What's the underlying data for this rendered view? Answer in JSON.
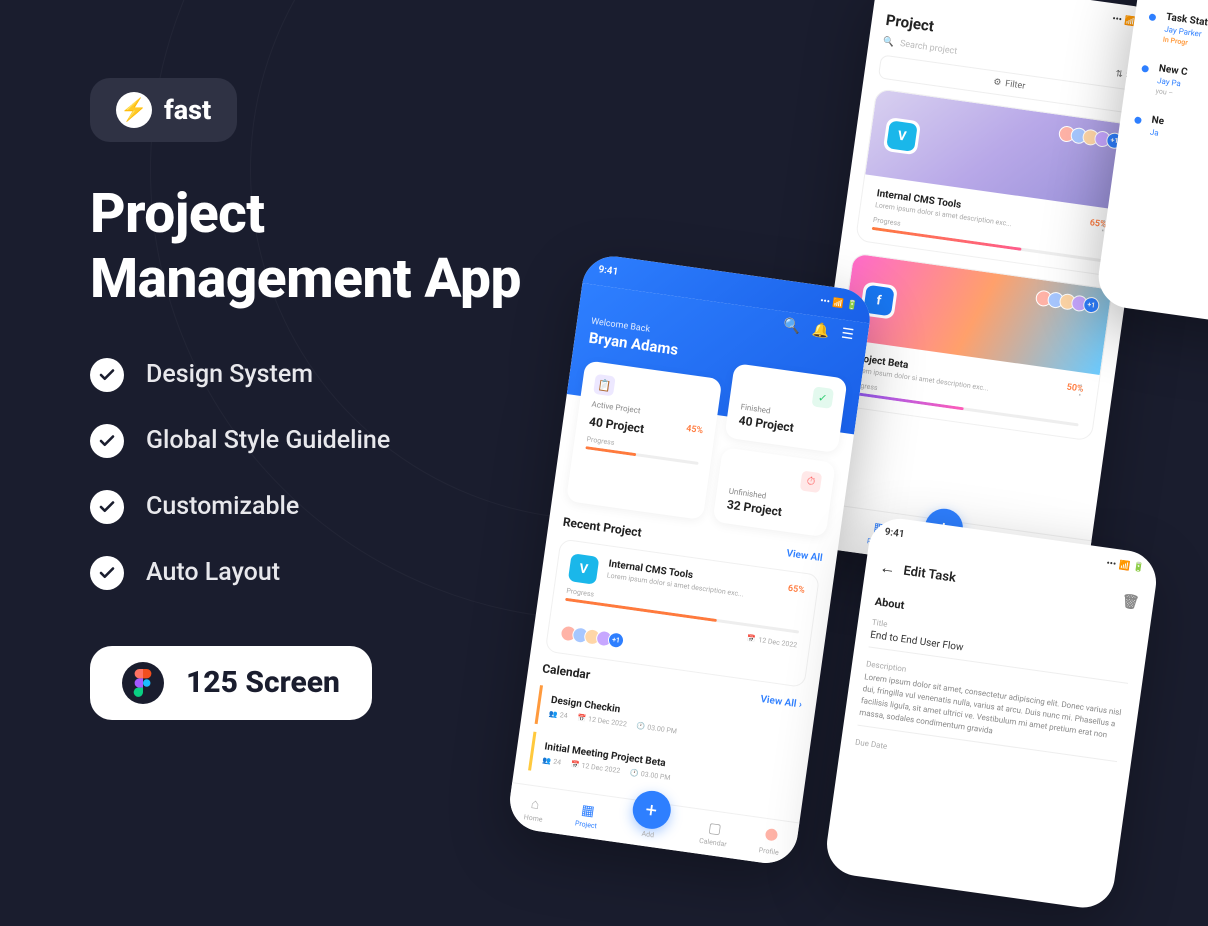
{
  "logo": {
    "text": "fast"
  },
  "title_line1": "Project",
  "title_line2": "Management App",
  "features": [
    "Design System",
    "Global Style Guideline",
    "Customizable",
    "Auto Layout"
  ],
  "screen_badge": "125 Screen",
  "time": "9:41",
  "home": {
    "welcome": "Welcome Back",
    "username": "Bryan Adams",
    "stats": {
      "active": {
        "label": "Active Project",
        "value": "40 Project",
        "pct": "45%"
      },
      "finished": {
        "label": "Finished",
        "value": "40 Project"
      },
      "unfinished": {
        "label": "Unfinished",
        "value": "32 Project"
      }
    },
    "progress_label": "Progress",
    "recent": {
      "title": "Recent Project",
      "view_all": "View All",
      "project": {
        "name": "Internal CMS Tools",
        "desc": "Lorem ipsum dolor si amet description exc...",
        "pct": "65%",
        "date": "12 Dec 2022",
        "more": "+1"
      }
    },
    "calendar": {
      "title": "Calendar",
      "view_all": "View All ›",
      "items": [
        {
          "name": "Design Checkin",
          "people": "24",
          "date": "12 Dec 2022",
          "time": "03.00 PM"
        },
        {
          "name": "Initial Meeting Project Beta",
          "people": "24",
          "date": "12 Dec 2022",
          "time": "03.00 PM"
        }
      ]
    }
  },
  "nav": {
    "home": "Home",
    "project": "Project",
    "add": "Add",
    "calendar": "Calendar",
    "profile": "Profile"
  },
  "project_list": {
    "title": "Project",
    "search": "Search project",
    "sort": "Sort",
    "filter": "Filter",
    "cards": [
      {
        "name": "Internal CMS Tools",
        "desc": "Lorem ipsum dolor si amet description exc...",
        "pct": "65%",
        "more": "+1"
      },
      {
        "name": "Project Beta",
        "desc": "Lorem ipsum dolor si amet description exc...",
        "pct": "50%",
        "more": "+1"
      }
    ],
    "progress_label": "Progress"
  },
  "notifications": [
    {
      "title": "Task Statu",
      "user": "Jay Parker",
      "status": "In Progr"
    },
    {
      "title": "New C",
      "user": "Jay Pa",
      "text": "you –"
    },
    {
      "title": "Ne",
      "user": "Ja"
    }
  ],
  "edit_task": {
    "header": "Edit Task",
    "about": "About",
    "title_label": "Title",
    "title_value": "End to End User Flow",
    "desc_label": "Description",
    "desc_value": "Lorem ipsum dolor sit amet, consectetur adipiscing elit. Donec varius nisl dui, fringilla vul venenatis nulla, varius at arcu. Duis nunc mi. Phasellus a facilisis ligula, sit amet ultrici ve. Vestibulum mi amet pretium erat non massa, sodales condimentum gravida",
    "due_label": "Due Date"
  }
}
